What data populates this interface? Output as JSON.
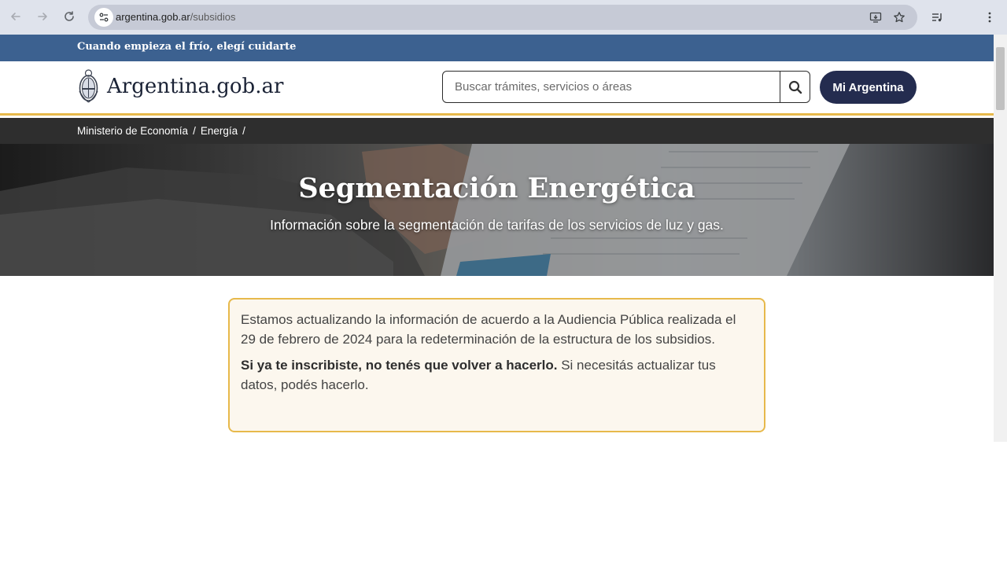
{
  "browser": {
    "url_host": "argentina.gob.ar",
    "url_path": "/subsidios"
  },
  "banner": {
    "text": "Cuando empieza el frío, elegí cuidarte"
  },
  "header": {
    "logo_text": "Argentina.gob.ar",
    "search_placeholder": "Buscar trámites, servicios o áreas",
    "mi_argentina_label": "Mi Argentina"
  },
  "breadcrumb": {
    "items": [
      {
        "label": "Ministerio de Economía",
        "sep": "/"
      },
      {
        "label": "Energía",
        "sep": "/"
      }
    ]
  },
  "hero": {
    "title": "Segmentación Energética",
    "subtitle": "Información sobre la segmentación de tarifas de los servicios de luz y gas."
  },
  "alert": {
    "paragraph1": "Estamos actualizando la información de acuerdo a la Audiencia Pública realizada el 29 de febrero de 2024 para la redeterminación de la estructura de los subsidios.",
    "paragraph2_bold": "Si ya te inscribiste, no tenés que volver a hacerlo.",
    "paragraph2_rest": " Si necesitás actualizar tus datos, podés hacerlo."
  },
  "colors": {
    "banner": "#3c6190",
    "header_accent": "#e7b94b",
    "breadcrumb_bg": "#2e2e2e",
    "primary_button": "#242c4f",
    "alert_bg": "#fcf7ee",
    "alert_border": "#e7b94b"
  }
}
